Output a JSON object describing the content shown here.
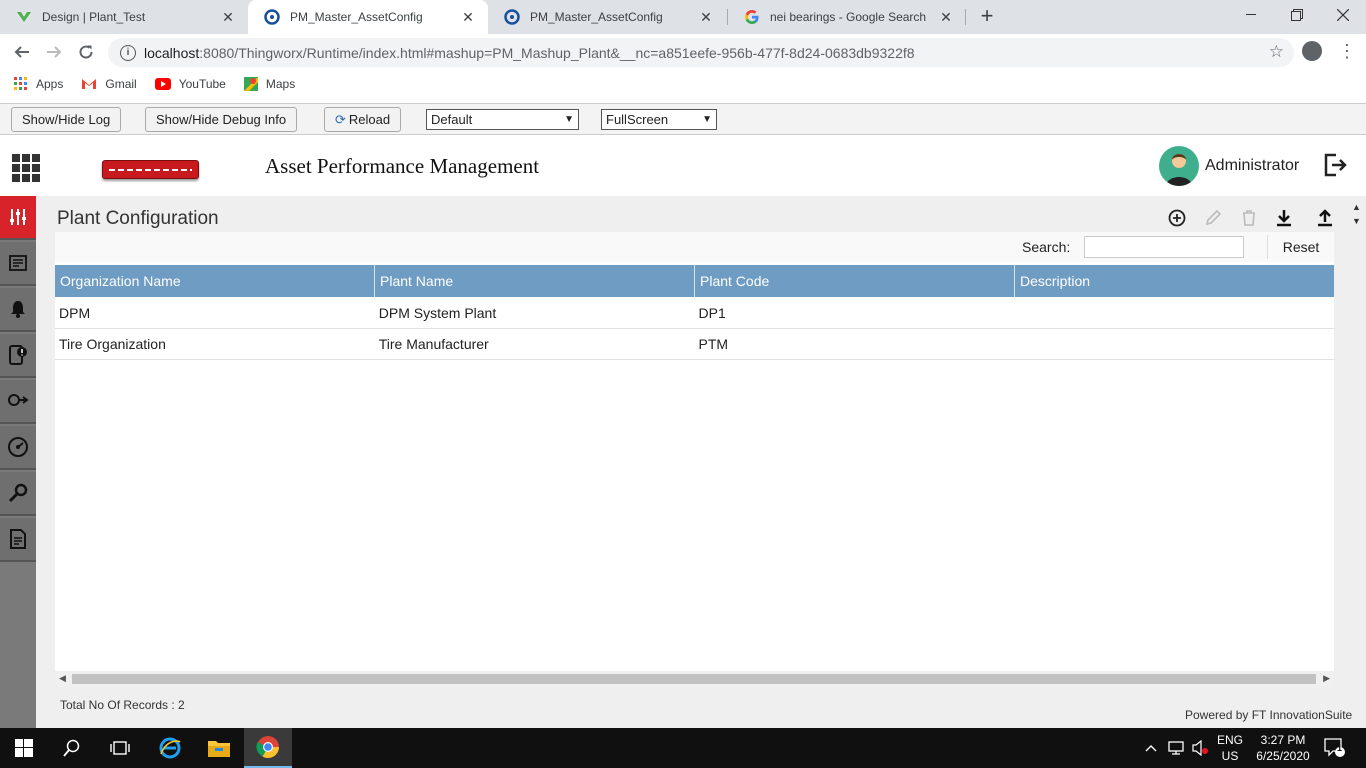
{
  "browser": {
    "tabs": [
      {
        "title": "Design | Plant_Test"
      },
      {
        "title": "PM_Master_AssetConfig"
      },
      {
        "title": "PM_Master_AssetConfig"
      },
      {
        "title": "nei bearings - Google Search"
      }
    ],
    "url_host": "localhost",
    "url_rest": ":8080/Thingworx/Runtime/index.html#mashup=PM_Mashup_Plant&__nc=a851eefe-956b-477f-8d24-0683db9322f8",
    "bookmarks": [
      {
        "label": "Apps"
      },
      {
        "label": "Gmail"
      },
      {
        "label": "YouTube"
      },
      {
        "label": "Maps"
      }
    ]
  },
  "debugbar": {
    "show_hide_log": "Show/Hide Log",
    "show_hide_debug": "Show/Hide Debug Info",
    "reload": "Reload",
    "select1_value": "Default",
    "select2_value": "FullScreen"
  },
  "app": {
    "title": "Asset Performance Management",
    "user": "Administrator",
    "accent_color": "#d9232a",
    "header_color": "#6f9cc2"
  },
  "page": {
    "title": "Plant Configuration",
    "search_label": "Search:",
    "search_value": "",
    "reset_label": "Reset",
    "columns": [
      "Organization Name",
      "Plant Name",
      "Plant Code",
      "Description"
    ],
    "rows": [
      {
        "org": "DPM",
        "plant": "DPM System Plant",
        "code": "DP1",
        "desc": ""
      },
      {
        "org": "Tire Organization",
        "plant": "Tire Manufacturer",
        "code": "PTM",
        "desc": ""
      }
    ],
    "total_records": "Total No Of Records : 2",
    "powered_by": "Powered by FT InnovationSuite"
  },
  "taskbar": {
    "lang_top": "ENG",
    "lang_bottom": "US",
    "time": "3:27 PM",
    "date": "6/25/2020",
    "notification_count": "1"
  }
}
